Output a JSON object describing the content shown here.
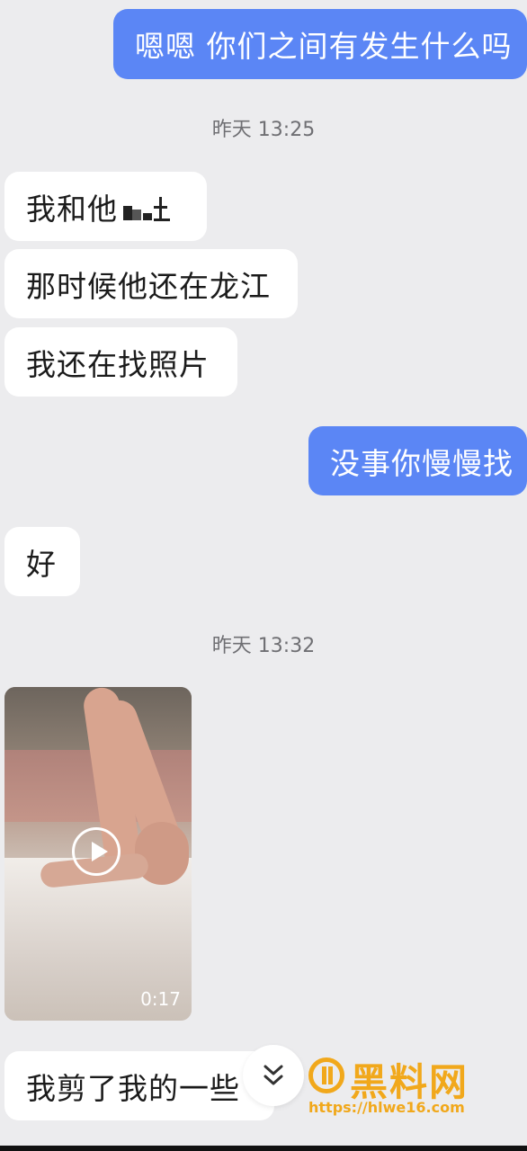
{
  "messages": [
    {
      "text": "嗯嗯 你们之间有发生什么吗"
    },
    {
      "text": "我和他"
    },
    {
      "text": "那时候他还在龙江"
    },
    {
      "text": "我还在找照片"
    },
    {
      "text": "没事你慢慢找"
    },
    {
      "text": "好"
    },
    {
      "text": "我剪了我的一些"
    }
  ],
  "timestamps": [
    "昨天 13:25",
    "昨天 13:32"
  ],
  "video": {
    "duration": "0:17",
    "icon": "play-icon"
  },
  "scroll_button": {
    "icon": "double-chevron-down-icon"
  },
  "watermark": {
    "title": "黑料网",
    "url": "https://hlwe16.com"
  },
  "colors": {
    "outgoing_bubble": "#5b86f5",
    "incoming_bubble": "#ffffff",
    "background": "#ececee",
    "watermark": "#f1a81b"
  }
}
